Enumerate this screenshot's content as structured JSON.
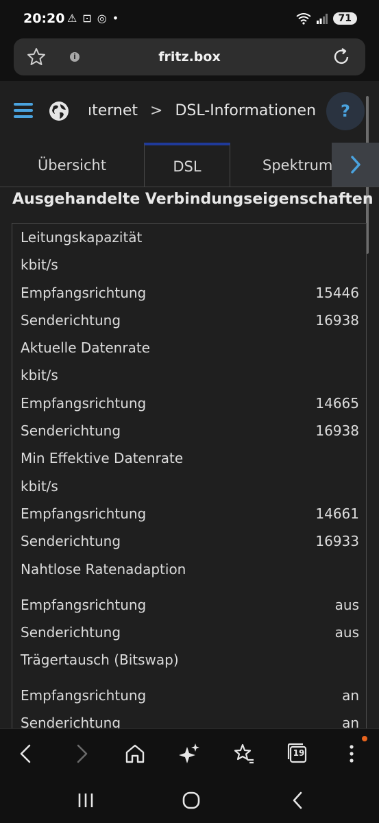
{
  "status_bar": {
    "time": "20:20",
    "battery": "71",
    "icons_left": [
      "warning-icon",
      "screenshot-icon",
      "whatsapp-icon",
      "dot"
    ],
    "icons_right": [
      "wifi-icon",
      "signal-icon",
      "battery-icon"
    ]
  },
  "browser": {
    "url": "fritz.box"
  },
  "header": {
    "breadcrumb_parent": "ıternet",
    "breadcrumb_separator": ">",
    "breadcrumb_current": "DSL-Informationen",
    "help_label": "?"
  },
  "tabs": {
    "items": [
      {
        "label": "Übersicht"
      },
      {
        "label": "DSL"
      },
      {
        "label": "Spektrum"
      }
    ],
    "active": "DSL",
    "next_arrow": "›"
  },
  "section": {
    "title": "Ausgehandelte Verbindungseigenschaften",
    "rows": [
      {
        "label": "Leitungskapazität",
        "value": ""
      },
      {
        "label": "kbit/s",
        "value": ""
      },
      {
        "label": "Empfangsrichtung",
        "value": "15446"
      },
      {
        "label": "Senderichtung",
        "value": "16938"
      },
      {
        "label": "Aktuelle Datenrate",
        "value": ""
      },
      {
        "label": "kbit/s",
        "value": ""
      },
      {
        "label": "Empfangsrichtung",
        "value": "14665"
      },
      {
        "label": "Senderichtung",
        "value": "16938"
      },
      {
        "label": "Min Effektive Datenrate",
        "value": ""
      },
      {
        "label": "kbit/s",
        "value": ""
      },
      {
        "label": "Empfangsrichtung",
        "value": "14661"
      },
      {
        "label": "Senderichtung",
        "value": "16933"
      },
      {
        "label": "Nahtlose Ratenadaption",
        "value": ""
      },
      {
        "label": "Empfangsrichtung",
        "value": "aus"
      },
      {
        "label": "Senderichtung",
        "value": "aus"
      },
      {
        "label": "Trägertausch (Bitswap)",
        "value": ""
      },
      {
        "label": "Empfangsrichtung",
        "value": "an"
      },
      {
        "label": "Senderichtung",
        "value": "an"
      }
    ]
  },
  "toolbar": {
    "tabs_count": "19"
  },
  "colors": {
    "accent": "#4aa3df",
    "active_tab_border": "#1f3a9a",
    "background": "#1f1f1f",
    "badge": "#e8641e"
  }
}
